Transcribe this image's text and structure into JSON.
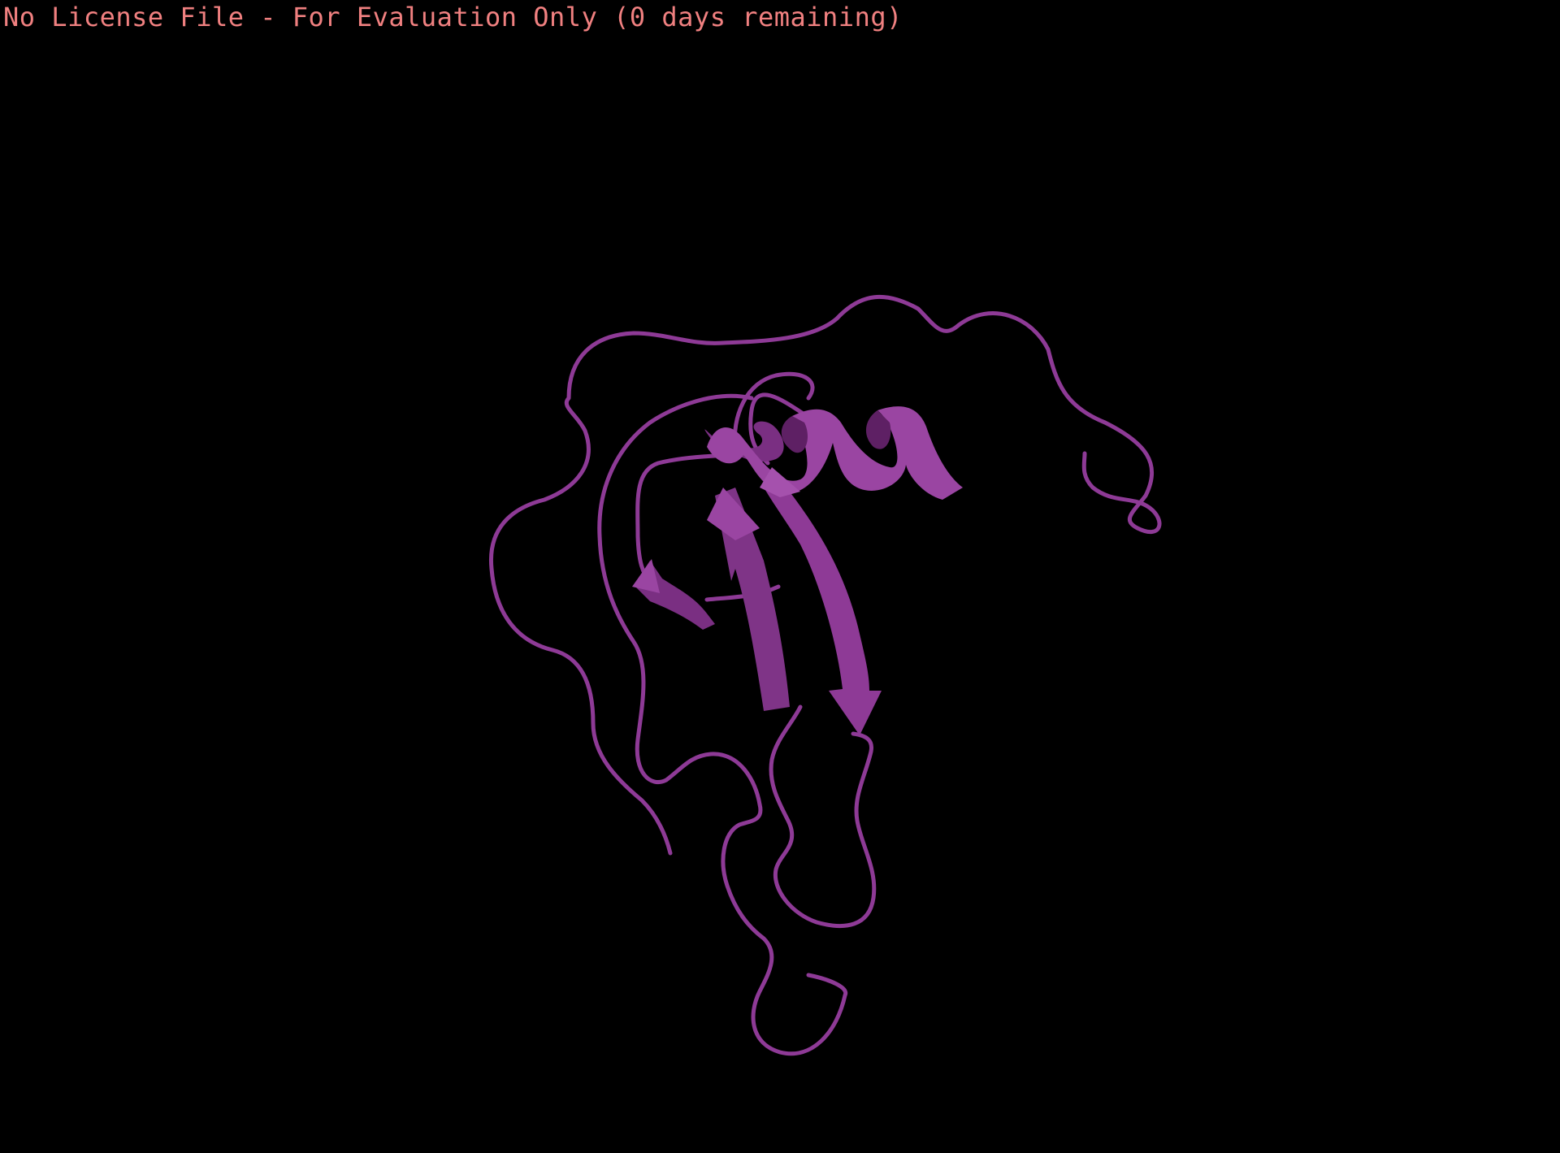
{
  "banner": {
    "text": "No License File - For Evaluation Only (0 days remaining)",
    "color": "#f08080"
  },
  "scene": {
    "background": "#000000",
    "cartoon_color": "#8e3a96",
    "cartoon_shadow": "#5e2064",
    "cartoon_highlight": "#b25cba"
  }
}
